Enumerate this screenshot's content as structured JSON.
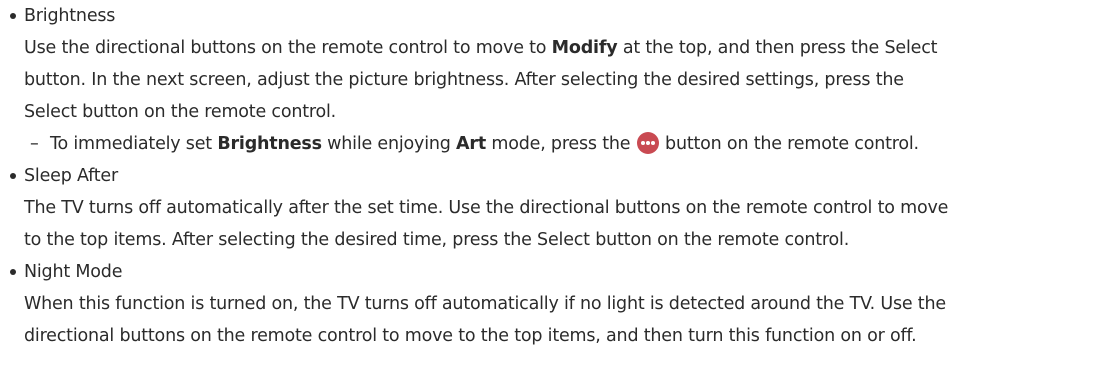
{
  "items": [
    {
      "title": "Brightness",
      "lines": [
        {
          "a": "Use the directional buttons on the remote control to move to ",
          "b": "Modify",
          "c": " at the top, and then press the Select"
        },
        {
          "text": "button. In the next screen, adjust the picture brightness. After selecting the desired settings, press the"
        },
        {
          "text": "Select button on the remote control."
        }
      ],
      "sub": {
        "dash": "–",
        "p1": "To immediately set ",
        "b1": "Brightness",
        "p2": " while enjoying ",
        "b2": "Art",
        "p3": " mode, press the ",
        "icon": "more-dots-icon",
        "p4": " button on the remote control."
      }
    },
    {
      "title": "Sleep After",
      "lines": [
        {
          "text": "The TV turns off automatically after the set time. Use the directional buttons on the remote control to move"
        },
        {
          "text": "to the top items. After selecting the desired time, press the Select button on the remote control."
        }
      ]
    },
    {
      "title": "Night Mode",
      "lines": [
        {
          "text": "When this function is turned on, the TV turns off automatically if no light is detected around the TV. Use the"
        },
        {
          "text": "directional buttons on the remote control to move to the top items, and then turn this function on or off."
        }
      ]
    }
  ],
  "colors": {
    "text": "#2b2b2b",
    "remote_button": "#c94a52"
  }
}
